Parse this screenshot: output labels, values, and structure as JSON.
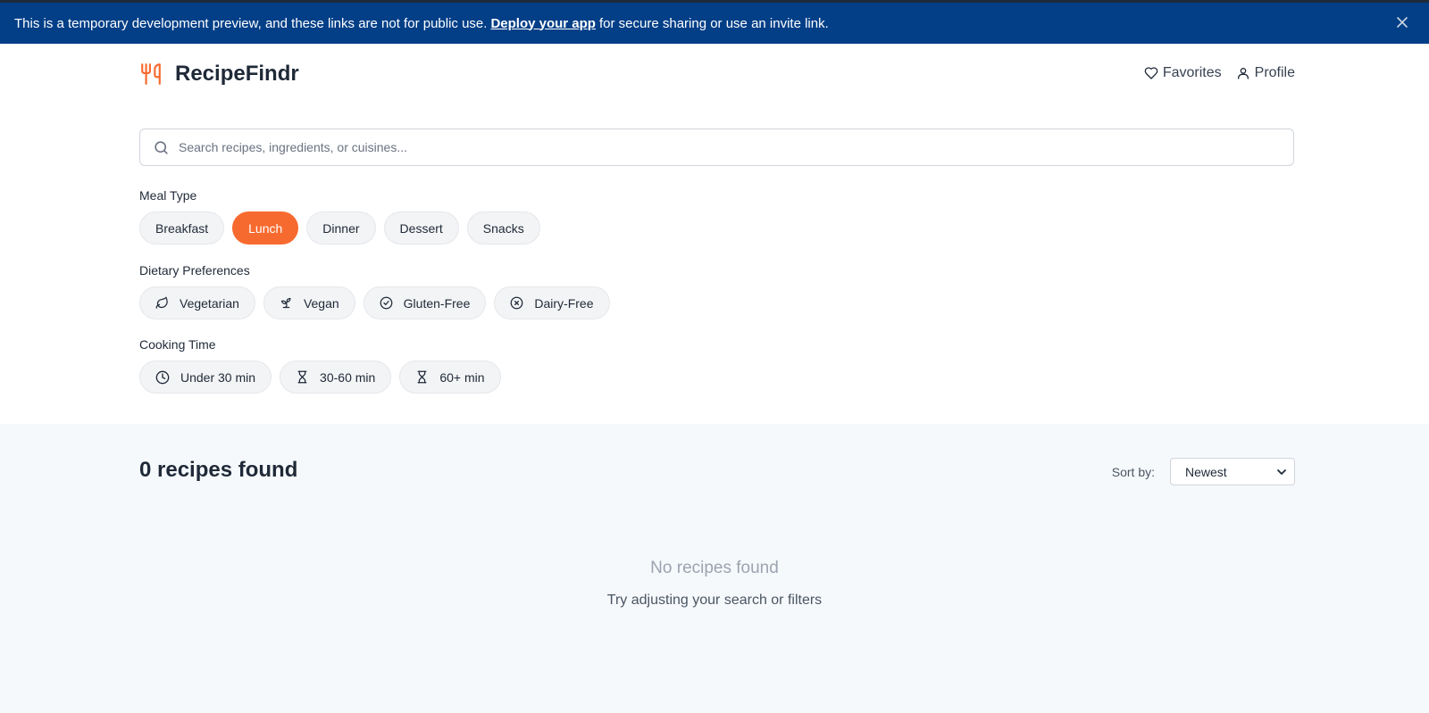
{
  "banner": {
    "text_before": "This is a temporary development preview, and these links are not for public use.",
    "link_label": "Deploy your app",
    "text_after": "for secure sharing or use an invite link.",
    "close_glyph": "×"
  },
  "header": {
    "logo_text": "RecipeFindr",
    "logo_icon": "utensils-icon",
    "nav": [
      {
        "label": "Favorites",
        "icon": "heart-icon"
      },
      {
        "label": "Profile",
        "icon": "user-icon"
      }
    ]
  },
  "search": {
    "placeholder": "Search recipes, ingredients, or cuisines...",
    "value": ""
  },
  "filters": {
    "meal_type": {
      "label": "Meal Type",
      "options": [
        "Breakfast",
        "Lunch",
        "Dinner",
        "Dessert",
        "Snacks"
      ],
      "selected": "Lunch"
    },
    "dietary": {
      "label": "Dietary Preferences",
      "options": [
        {
          "label": "Vegetarian",
          "icon": "leaf-icon"
        },
        {
          "label": "Vegan",
          "icon": "sprout-icon"
        },
        {
          "label": "Gluten-Free",
          "icon": "check-circle-icon"
        },
        {
          "label": "Dairy-Free",
          "icon": "x-circle-icon"
        }
      ]
    },
    "cooking_time": {
      "label": "Cooking Time",
      "options": [
        {
          "label": "Under 30 min",
          "icon": "clock-icon"
        },
        {
          "label": "30-60 min",
          "icon": "hourglass-icon"
        },
        {
          "label": "60+ min",
          "icon": "hourglass-icon"
        }
      ]
    }
  },
  "results": {
    "count_label": "0 recipes found",
    "sort_label": "Sort by:",
    "sort_value": "Newest",
    "empty_title": "No recipes found",
    "empty_subtitle": "Try adjusting your search or filters"
  },
  "colors": {
    "accent": "#f76a2f",
    "banner": "#033f87"
  }
}
